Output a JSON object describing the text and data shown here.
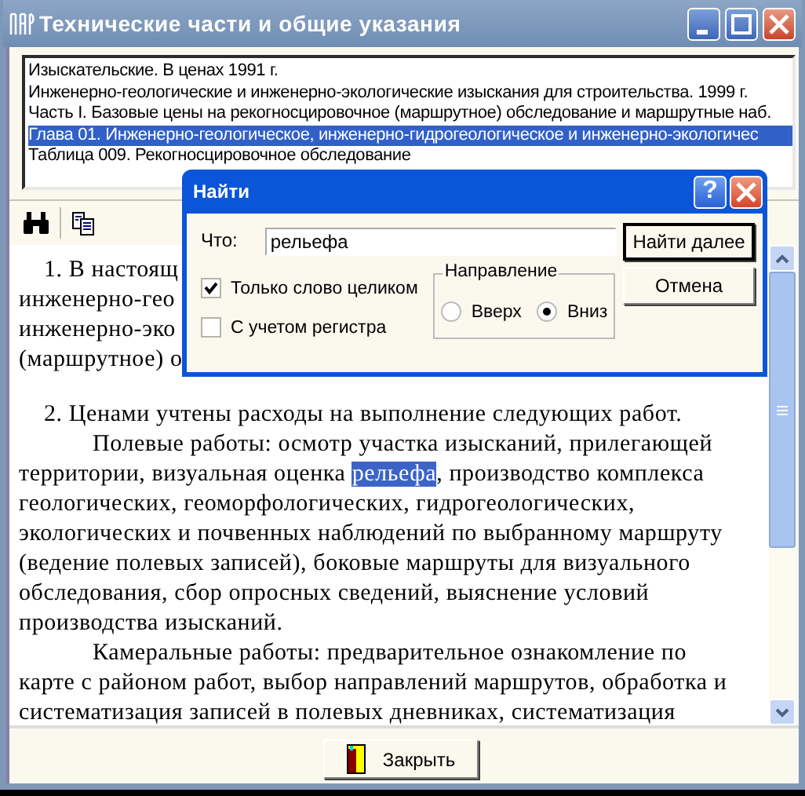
{
  "window": {
    "title": "Технические части и общие указания"
  },
  "breadcrumbs": [
    {
      "label": "Изыскательские. В ценах 1991 г.",
      "selected": false
    },
    {
      "label": "Инженерно-геологические и инженерно-экологические изыскания для строительства. 1999 г.",
      "selected": false
    },
    {
      "label": "Часть I. Базовые цены на рекогносцировочное (маршрутное) обследование и маршрутные наб.",
      "selected": false
    },
    {
      "label": "Глава 01. Инженерно-геологическое, инженерно-гидрогеологическое и инженерно-экологичес",
      "selected": true
    },
    {
      "label": "Таблица 009. Рекогносцировочное обследование",
      "selected": false
    }
  ],
  "document": {
    "lines": [
      {
        "kind": "numbered",
        "space_before": false,
        "segments": [
          {
            "text": "1. В настоящ",
            "highlighted": false
          }
        ]
      },
      {
        "kind": "continuation",
        "space_before": false,
        "segments": [
          {
            "text": "инженерно-гео",
            "highlighted": false
          }
        ]
      },
      {
        "kind": "continuation",
        "space_before": false,
        "segments": [
          {
            "text": "инженерно-эко",
            "highlighted": false
          }
        ]
      },
      {
        "kind": "continuation",
        "space_before": false,
        "segments": [
          {
            "text": "(маршрутное) о",
            "highlighted": false
          }
        ]
      },
      {
        "kind": "numbered",
        "space_before": true,
        "segments": [
          {
            "text": "2. Ценами учтены расходы на выполнение следующих работ.",
            "highlighted": false
          }
        ]
      },
      {
        "kind": "paragraph",
        "space_before": false,
        "segments": [
          {
            "text": "Полевые работы: осмотр участка изысканий, прилегающей",
            "highlighted": false
          }
        ]
      },
      {
        "kind": "continuation",
        "space_before": false,
        "segments": [
          {
            "text": "территории, визуальная оценка ",
            "highlighted": false
          },
          {
            "text": "рельефа",
            "highlighted": true
          },
          {
            "text": ", производство комплекса",
            "highlighted": false
          }
        ]
      },
      {
        "kind": "continuation",
        "space_before": false,
        "segments": [
          {
            "text": "геологических, геоморфологических, гидрогеологических,",
            "highlighted": false
          }
        ]
      },
      {
        "kind": "continuation",
        "space_before": false,
        "segments": [
          {
            "text": "экологических и почвенных наблюдений по выбранному маршруту",
            "highlighted": false
          }
        ]
      },
      {
        "kind": "continuation",
        "space_before": false,
        "segments": [
          {
            "text": "(ведение полевых записей), боковые маршруты для визуального",
            "highlighted": false
          }
        ]
      },
      {
        "kind": "continuation",
        "space_before": false,
        "segments": [
          {
            "text": "обследования, сбор опросных сведений, выяснение условий",
            "highlighted": false
          }
        ]
      },
      {
        "kind": "continuation",
        "space_before": false,
        "segments": [
          {
            "text": "производства изысканий.",
            "highlighted": false
          }
        ]
      },
      {
        "kind": "paragraph",
        "space_before": false,
        "segments": [
          {
            "text": "Камеральные работы: предварительное ознакомление по",
            "highlighted": false
          }
        ]
      },
      {
        "kind": "continuation",
        "space_before": false,
        "segments": [
          {
            "text": "карте с районом работ, выбор направлений маршрутов, обработка и",
            "highlighted": false
          }
        ]
      },
      {
        "kind": "continuation",
        "space_before": false,
        "segments": [
          {
            "text": "систематизация записей в полевых дневниках, систематизация",
            "highlighted": false
          }
        ]
      }
    ]
  },
  "footer": {
    "close_button": "Закрыть"
  },
  "find_dialog": {
    "title": "Найти",
    "help_button": "?",
    "what_label": "Что:",
    "what_value": "рельефа",
    "find_next_button": "Найти далее",
    "cancel_button": "Отмена",
    "options": [
      {
        "label": "Только слово целиком",
        "checked": true
      },
      {
        "label": "С учетом регистра",
        "checked": false
      }
    ],
    "direction": {
      "title": "Направление",
      "choices": [
        {
          "label": "Вверх",
          "selected": false
        },
        {
          "label": "Вниз",
          "selected": true
        }
      ]
    }
  }
}
